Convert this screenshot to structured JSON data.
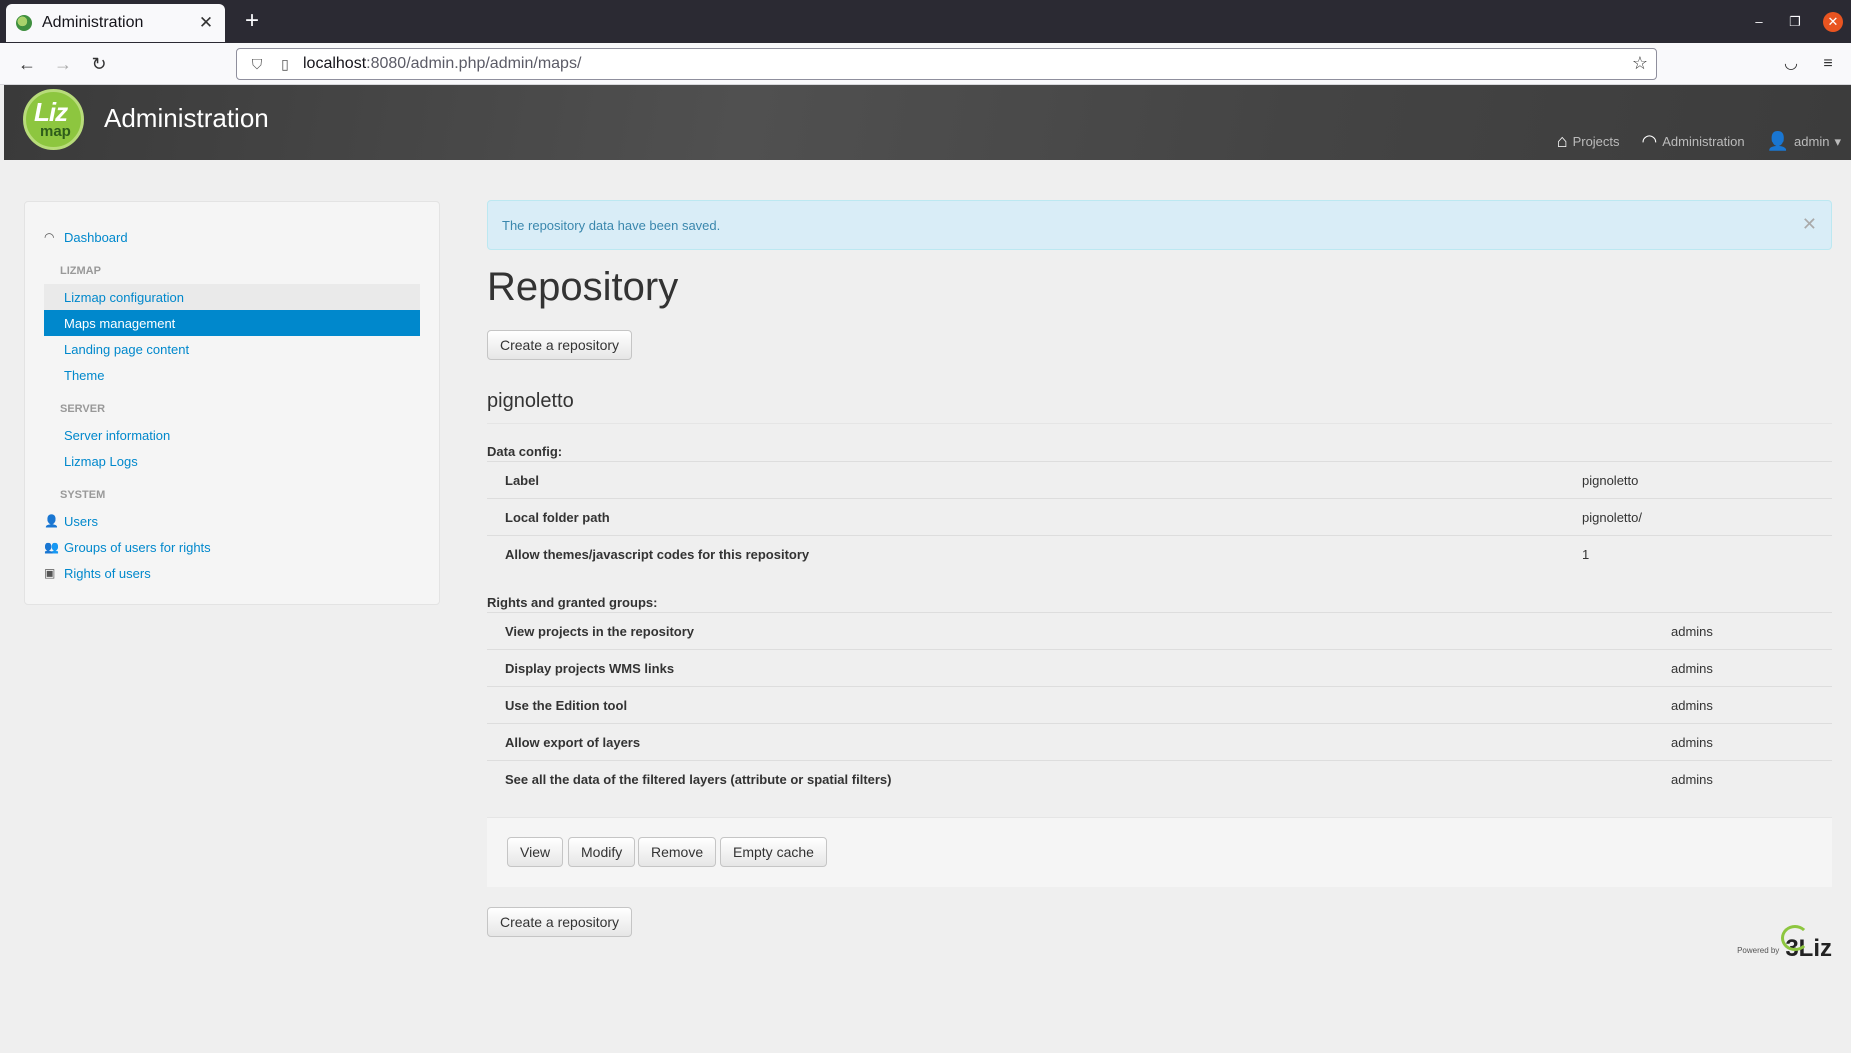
{
  "browser": {
    "tab_title": "Administration",
    "url_host": "localhost",
    "url_rest": ":8080/admin.php/admin/maps/"
  },
  "header": {
    "app_title": "Administration",
    "logo_top": "Liz",
    "logo_bottom": "map",
    "nav": {
      "projects": "Projects",
      "administration": "Administration",
      "user": "admin"
    }
  },
  "sidebar": {
    "dashboard": "Dashboard",
    "sections": [
      {
        "title": "LIZMAP",
        "items": [
          "Lizmap configuration",
          "Maps management",
          "Landing page content",
          "Theme"
        ]
      },
      {
        "title": "SERVER",
        "items": [
          "Server information",
          "Lizmap Logs"
        ]
      },
      {
        "title": "SYSTEM",
        "items": [
          "Users",
          "Groups of users for rights",
          "Rights of users"
        ]
      }
    ]
  },
  "main": {
    "alert": "The repository data have been saved.",
    "title": "Repository",
    "create_button": "Create a repository",
    "repo_name": "pignoletto",
    "data_config_label": "Data config:",
    "data_config": [
      {
        "key": "Label",
        "value": "pignoletto"
      },
      {
        "key": "Local folder path",
        "value": "pignoletto/"
      },
      {
        "key": "Allow themes/javascript codes for this repository",
        "value": "1"
      }
    ],
    "rights_label": "Rights and granted groups:",
    "rights": [
      {
        "key": "View projects in the repository",
        "value": "admins"
      },
      {
        "key": "Display projects WMS links",
        "value": "admins"
      },
      {
        "key": "Use the Edition tool",
        "value": "admins"
      },
      {
        "key": "Allow export of layers",
        "value": "admins"
      },
      {
        "key": "See all the data of the filtered layers (attribute or spatial filters)",
        "value": "admins"
      }
    ],
    "actions": {
      "view": "View",
      "modify": "Modify",
      "remove": "Remove",
      "empty_cache": "Empty cache"
    }
  },
  "footer": {
    "powered_by": "Powered by",
    "brand": "3Liz"
  }
}
